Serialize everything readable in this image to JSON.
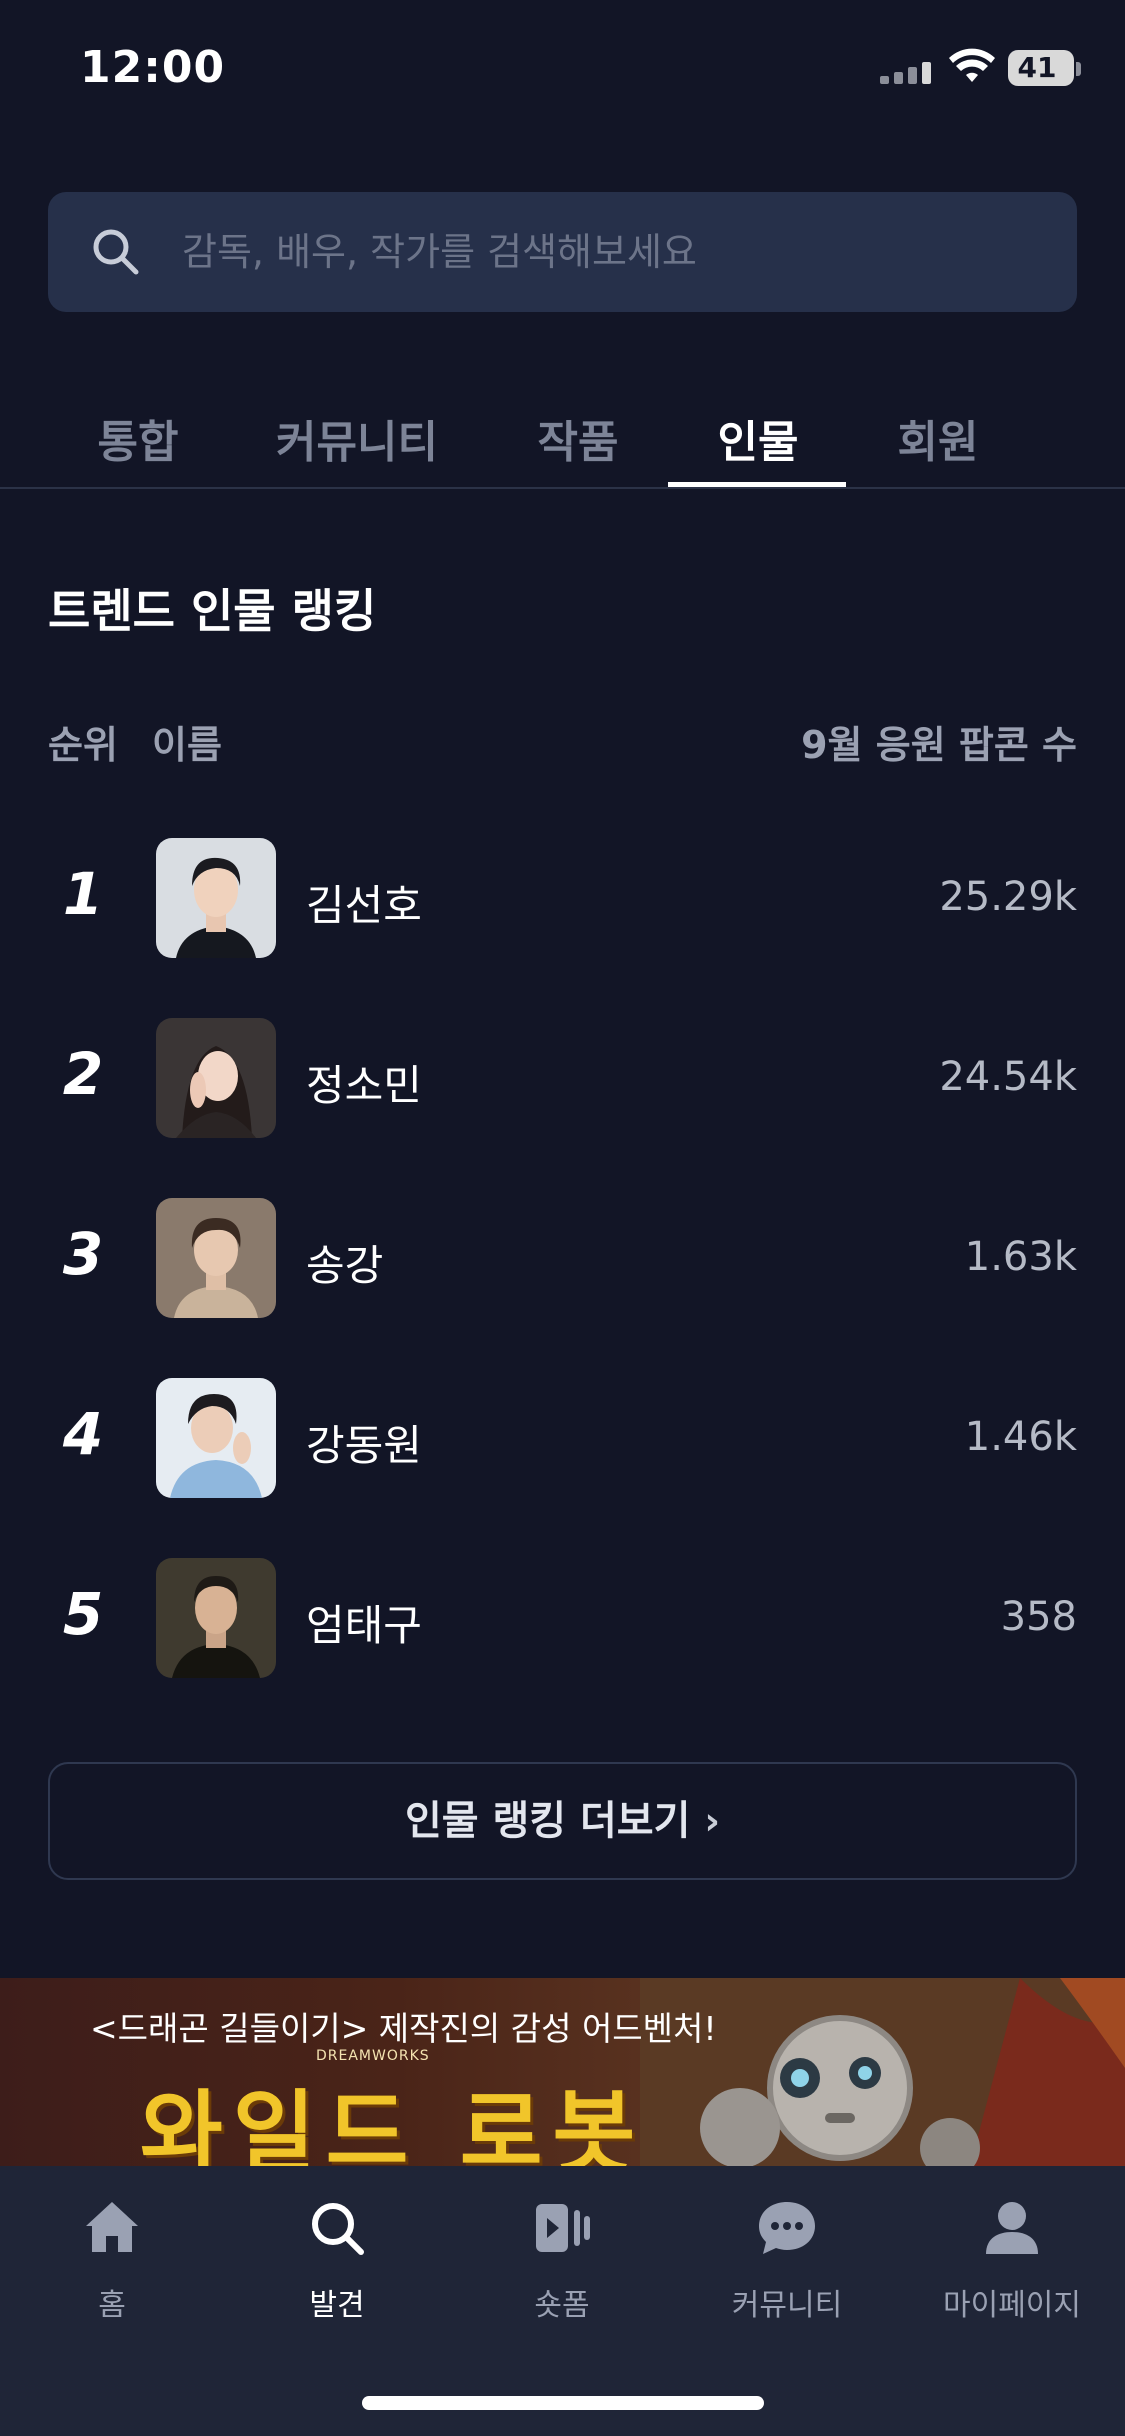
{
  "status_bar": {
    "time": "12:00",
    "battery": "41"
  },
  "search": {
    "placeholder": "감독, 배우, 작가를 검색해보세요",
    "value": ""
  },
  "tabs": [
    {
      "label": "통합",
      "active": false
    },
    {
      "label": "커뮤니티",
      "active": false
    },
    {
      "label": "작품",
      "active": false
    },
    {
      "label": "인물",
      "active": true
    },
    {
      "label": "회원",
      "active": false
    }
  ],
  "ranking": {
    "title": "트렌드 인물 랭킹",
    "headers": {
      "rank": "순위",
      "name": "이름",
      "fans": "9월 응원 팝콘 수"
    },
    "rows": [
      {
        "rank": "1",
        "name": "김선호",
        "fans": "25.29k"
      },
      {
        "rank": "2",
        "name": "정소민",
        "fans": "24.54k"
      },
      {
        "rank": "3",
        "name": "송강",
        "fans": "1.63k"
      },
      {
        "rank": "4",
        "name": "강동원",
        "fans": "1.46k"
      },
      {
        "rank": "5",
        "name": "엄태구",
        "fans": "358"
      }
    ],
    "more_label": "인물 랭킹 더보기"
  },
  "banner": {
    "subtitle": "<드래곤 길들이기> 제작진의 감성 어드벤처!",
    "brand": "DREAMWORKS",
    "title": "와일드 로봇"
  },
  "bottom_nav": [
    {
      "label": "홈",
      "icon": "home-icon",
      "active": false
    },
    {
      "label": "발견",
      "icon": "search-icon",
      "active": true
    },
    {
      "label": "숏폼",
      "icon": "shortform-icon",
      "active": false
    },
    {
      "label": "커뮤니티",
      "icon": "chat-icon",
      "active": false
    },
    {
      "label": "마이페이지",
      "icon": "person-icon",
      "active": false
    }
  ],
  "colors": {
    "background": "#121526",
    "accent": "#ffffff",
    "muted": "#7d8497",
    "search_bg": "#26304a"
  }
}
